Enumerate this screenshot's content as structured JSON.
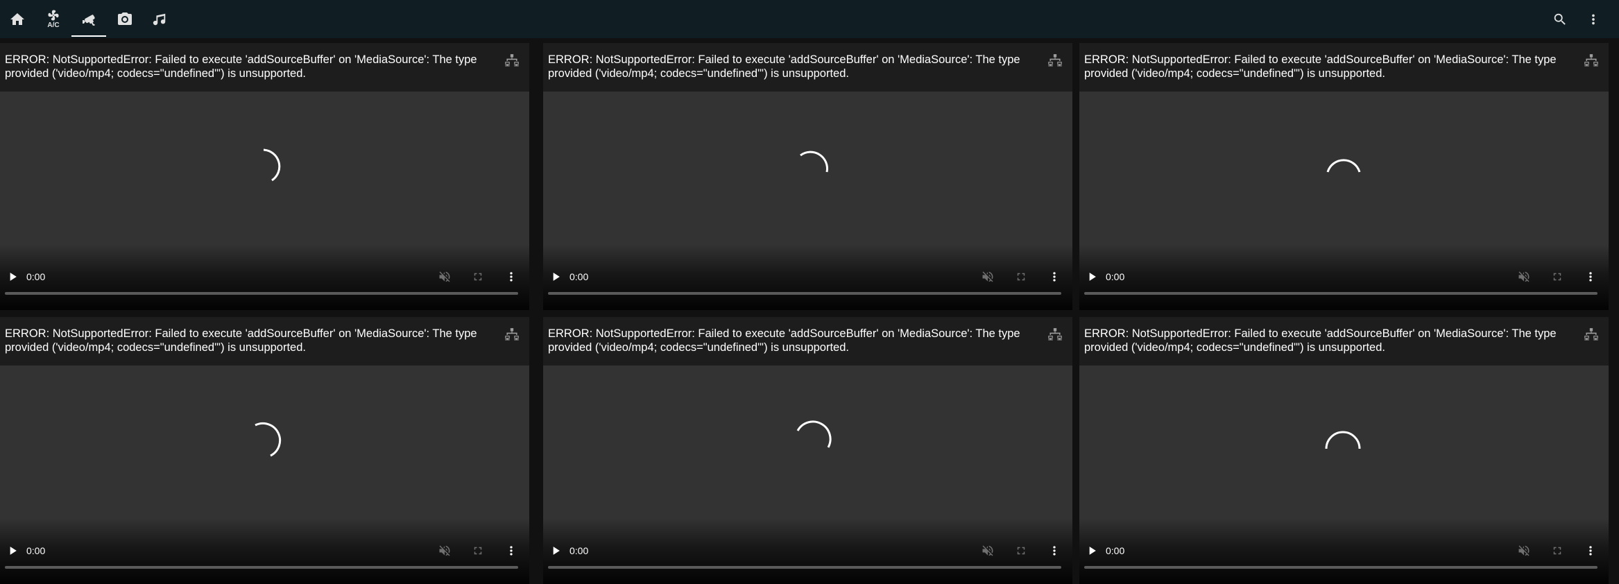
{
  "tabs": [
    {
      "icon": "home-icon"
    },
    {
      "icon": "fan-icon",
      "label": "A/C"
    },
    {
      "icon": "cctv-icon",
      "active": true
    },
    {
      "icon": "camera-icon"
    },
    {
      "icon": "music-note-icon"
    }
  ],
  "actions": [
    {
      "icon": "search-icon"
    },
    {
      "icon": "more-vertical-icon"
    }
  ],
  "cameras": [
    {
      "error": "ERROR: NotSupportedError: Failed to execute 'addSourceBuffer' on 'MediaSource': The type provided ('video/mp4; codecs=\"undefined\"') is unsupported.",
      "time": "0:00"
    },
    {
      "error": "ERROR: NotSupportedError: Failed to execute 'addSourceBuffer' on 'MediaSource': The type provided ('video/mp4; codecs=\"undefined\"') is unsupported.",
      "time": "0:00"
    },
    {
      "error": "ERROR: NotSupportedError: Failed to execute 'addSourceBuffer' on 'MediaSource': The type provided ('video/mp4; codecs=\"undefined\"') is unsupported.",
      "time": "0:00"
    },
    {
      "error": "ERROR: NotSupportedError: Failed to execute 'addSourceBuffer' on 'MediaSource': The type provided ('video/mp4; codecs=\"undefined\"') is unsupported.",
      "time": "0:00"
    },
    {
      "error": "ERROR: NotSupportedError: Failed to execute 'addSourceBuffer' on 'MediaSource': The type provided ('video/mp4; codecs=\"undefined\"') is unsupported.",
      "time": "0:00"
    },
    {
      "error": "ERROR: NotSupportedError: Failed to execute 'addSourceBuffer' on 'MediaSource': The type provided ('video/mp4; codecs=\"undefined\"') is unsupported.",
      "time": "0:00"
    }
  ],
  "colors": {
    "topbar": "#101e24",
    "video_bg": "#333333",
    "text": "#ffffff"
  }
}
